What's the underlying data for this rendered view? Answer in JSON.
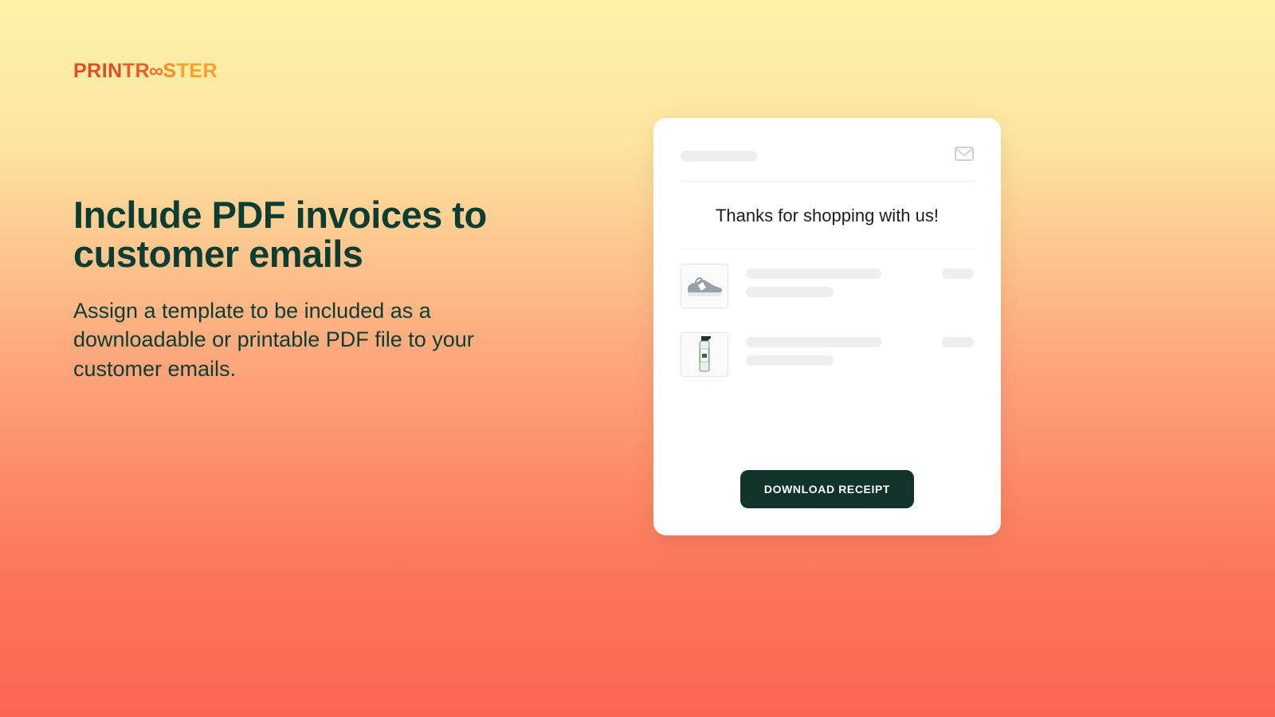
{
  "brand": {
    "name": "PRINTROOSTER",
    "seg1": "PRIN",
    "seg2": "TR",
    "infinity": "∞",
    "seg3": "S",
    "seg4": "TER"
  },
  "hero": {
    "title": "Include PDF invoices to customer emails",
    "subtitle": "Assign a template to be included as a downloadable or printable PDF file to your customer emails."
  },
  "email_card": {
    "thanks": "Thanks for shopping with us!",
    "button_label": "DOWNLOAD RECEIPT",
    "items": [
      {
        "icon": "sneaker"
      },
      {
        "icon": "bottle"
      }
    ]
  },
  "icons": {
    "mail": "mail-icon",
    "sneaker": "sneaker-icon",
    "bottle": "bottle-icon"
  },
  "colors": {
    "brand_dark": "#0b3d33",
    "button_bg": "#12332b",
    "placeholder": "#eeeeee"
  }
}
